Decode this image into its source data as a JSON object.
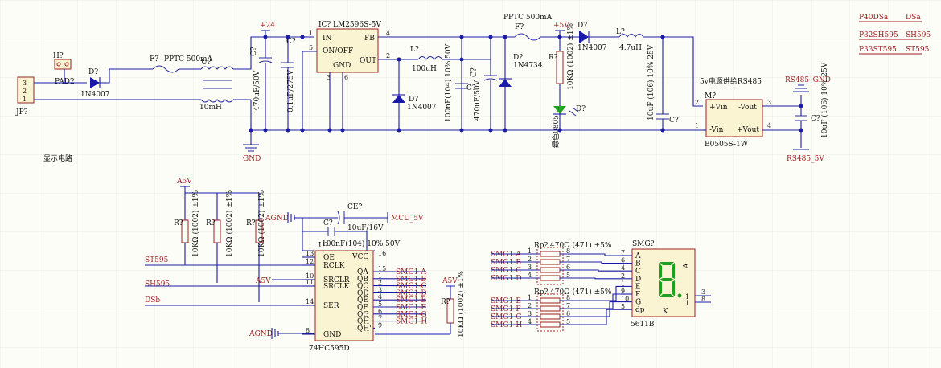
{
  "colors": {
    "wire": "#1a1aa8",
    "part": "#a02020",
    "body": "#fbf4d2",
    "grid": "#ecece0"
  },
  "power": {
    "jp_label": "JP?",
    "jp_pins": [
      "3",
      "2",
      "1"
    ],
    "h_label": "H?",
    "pad_label": "PAD2",
    "d_in": "D?",
    "d_in_part": "1N4007",
    "fuse1": "F?",
    "fuse1_part": "PPTC 500mA",
    "cm_label": "U?",
    "cm_part": "10mH",
    "vin_net": "+24",
    "c1_label": "C?",
    "c1_val": "470uF/50V",
    "c2_label": "C?",
    "c2_val": "0.1uF/275V",
    "ic_label": "IC?",
    "ic_part": "LM2596S-5V",
    "ic_in": "IN",
    "ic_onoff": "ON/OFF",
    "ic_gnd": "GND",
    "ic_fb": "FB",
    "ic_out": "OUT",
    "ic_pins": [
      "1",
      "5",
      "3",
      "6",
      "4",
      "2"
    ],
    "d_fw": "D?",
    "d_fw_part": "1N4007",
    "l1_label": "L?",
    "l1_val": "100uH",
    "c3_label": "C?",
    "c3_val": "100nF(104) 10% 50V",
    "c4_label": "C?",
    "c4_val": "470uF/50V",
    "fuse2": "F?",
    "fuse2_part": "PPTC 500mA",
    "dz_label": "D?",
    "dz_part": "1N4734",
    "v5_net": "+5V",
    "r_led": "R?",
    "r_led_val": "10KΩ (1002) ±1%",
    "led_label": "D?",
    "led_part": "绿色0805",
    "d_out": "D?",
    "d_out_part": "1N4007",
    "l2_label": "L?",
    "l2_val": "4.7uH",
    "c5_label": "C?",
    "c5_val": "10uF (106) 10% 25V",
    "m_title": "5v电源供给RS485",
    "m_label": "M?",
    "m_part": "B0505S-1W",
    "m_pins": {
      "vin_p": "+Vin",
      "vin_n": "-Vin",
      "vout_n": "-Vout",
      "vout_p": "+Vout"
    },
    "m_pin_nums": [
      "2",
      "1",
      "3",
      "4"
    ],
    "rs485_gnd": "RS485_GND",
    "c6_label": "C?",
    "c6_val": "10uF (106) 10% 25V",
    "rs485_5v": "RS485_5V",
    "gnd_net": "GND",
    "section_label": "显示电路"
  },
  "net_table": [
    {
      "left": "P40DSa",
      "right": "DSa"
    },
    {
      "left": "P32SH595",
      "right": "SH595"
    },
    {
      "left": "P33ST595",
      "right": "ST595"
    }
  ],
  "display": {
    "a5v": "A5V",
    "r_vals": [
      "10KΩ (1002) ±1%",
      "10KΩ (1002) ±1%",
      "10KΩ (1002) ±1%"
    ],
    "r_label": "R?",
    "agnd": "AGND",
    "mcu5v": "MCU_5V",
    "ce_label": "CE?",
    "ce_val": "10uF/16V",
    "c7_label": "C?",
    "c7_val": "100nF(104) 10% 50V",
    "u_label": "U?",
    "u_part": "74HC595D",
    "u_pins_left": [
      {
        "num": "13",
        "name": "OE"
      },
      {
        "num": "12",
        "name": "RCLK"
      },
      {
        "num": "10",
        "name": "SRCLR"
      },
      {
        "num": "11",
        "name": "SRCLK"
      },
      {
        "num": "14",
        "name": "SER"
      },
      {
        "num": "8",
        "name": "GND"
      }
    ],
    "u_vcc": {
      "num": "16",
      "name": "VCC"
    },
    "u_pins_right": [
      {
        "num": "15",
        "name": "QA",
        "net": "SMG1-A"
      },
      {
        "num": "1",
        "name": "QB",
        "net": "SMG1-B"
      },
      {
        "num": "2",
        "name": "QC",
        "net": "SMG1-C"
      },
      {
        "num": "3",
        "name": "QD",
        "net": "SMG1-D"
      },
      {
        "num": "4",
        "name": "QE",
        "net": "SMG1-E"
      },
      {
        "num": "5",
        "name": "QF",
        "net": "SMG1-F"
      },
      {
        "num": "6",
        "name": "QG",
        "net": "SMG1-G"
      },
      {
        "num": "7",
        "name": "QH",
        "net": "SMG1-H"
      },
      {
        "num": "9",
        "name": "QH'",
        "net": ""
      }
    ],
    "st595": "ST595",
    "sh595": "SH595",
    "dsb": "DSb",
    "a5v_2": "A5V",
    "agnd_2": "AGND",
    "r4_label": "R?",
    "r4_val": "10KΩ (1002) ±1%",
    "rp1_label": "Rp?",
    "rp1_val": "470Ω (471) ±5%",
    "rp2_label": "Rp?",
    "rp2_val": "470Ω (471) ±5%",
    "rp1_nets": [
      "SMG1-A",
      "SMG1-B",
      "SMG1-C",
      "SMG1-D"
    ],
    "rp2_nets": [
      "SMG1-E",
      "SMG1-F",
      "SMG1-G",
      "SMG1-H"
    ],
    "rp1_pins_l": [
      "1",
      "2",
      "3",
      "4"
    ],
    "rp1_pins_r": [
      "8",
      "7",
      "6",
      "5"
    ],
    "rp2_pins_l": [
      "1",
      "2",
      "3",
      "4"
    ],
    "rp2_pins_r": [
      "8",
      "7",
      "6",
      "5"
    ],
    "smg_label": "SMG?",
    "smg_part": "5611B",
    "smg_segs": [
      "A",
      "B",
      "C",
      "D",
      "E",
      "F",
      "G",
      "dp"
    ],
    "smg_seg_pins": [
      "7",
      "6",
      "4",
      "2",
      "1",
      "9",
      "10",
      "5"
    ],
    "smg_a": "A",
    "smg_k": "K",
    "smg_com_pins": [
      "3",
      "8"
    ],
    "smg_com_labels": [
      "1",
      "1"
    ]
  }
}
